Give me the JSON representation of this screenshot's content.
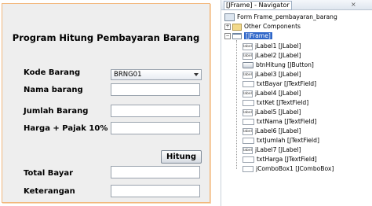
{
  "form": {
    "title": "Program Hitung Pembayaran Barang",
    "labels": {
      "kode": "Kode Barang",
      "nama": "Nama barang",
      "jumlah": "Jumlah Barang",
      "harga": "Harga + Pajak 10%",
      "total": "Total Bayar",
      "keterangan": "Keterangan"
    },
    "combo_value": "BRNG01",
    "button_label": "Hitung"
  },
  "navigator": {
    "tab_title": "[JFrame] - Navigator",
    "close_symbol": "×",
    "root": "Form Frame_pembayaran_barang",
    "other_components": "Other Components",
    "jframe": "[JFrame]",
    "label_icon_text": "label",
    "items": [
      {
        "text": "jLabel1 [JLabel]",
        "icon": "label-icon"
      },
      {
        "text": "jLabel2 [JLabel]",
        "icon": "label-icon"
      },
      {
        "text": "btnHitung [JButton]",
        "icon": "button-icon"
      },
      {
        "text": "jLabel3 [JLabel]",
        "icon": "label-icon"
      },
      {
        "text": "txtBayar [JTextField]",
        "icon": "textfield-icon"
      },
      {
        "text": "jLabel4 [JLabel]",
        "icon": "label-icon"
      },
      {
        "text": "txtKet [JTextField]",
        "icon": "textfield-icon"
      },
      {
        "text": "jLabel5 [JLabel]",
        "icon": "label-icon"
      },
      {
        "text": "txtNama [JTextField]",
        "icon": "textfield-icon"
      },
      {
        "text": "jLabel6 [JLabel]",
        "icon": "label-icon"
      },
      {
        "text": "txtJumlah [JTextField]",
        "icon": "textfield-icon"
      },
      {
        "text": "jLabel7 [JLabel]",
        "icon": "label-icon"
      },
      {
        "text": "txtHarga [JTextField]",
        "icon": "textfield-icon"
      },
      {
        "text": "jComboBox1 [JComboBox]",
        "icon": "combobox-icon"
      }
    ]
  }
}
